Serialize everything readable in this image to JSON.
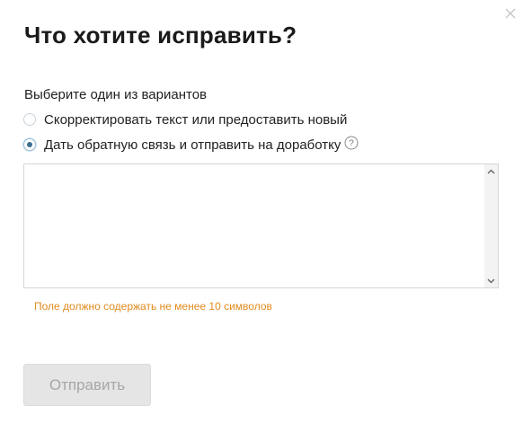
{
  "dialog": {
    "title": "Что хотите исправить?",
    "prompt": "Выберите один из вариантов",
    "options": [
      {
        "label": "Скорректировать текст или предоставить новый",
        "selected": false
      },
      {
        "label": "Дать обратную связь и отправить на доработку",
        "selected": true,
        "has_help_icon": true
      }
    ],
    "feedback_field": {
      "value": "",
      "placeholder": ""
    },
    "error_message": "Поле должно содержать не менее 10 символов",
    "submit_label": "Отправить",
    "submit_enabled": false
  },
  "colors": {
    "error": "#e08b1e",
    "radio_checked": "#3a6f8f",
    "button_disabled_bg": "#e5e5e5",
    "button_disabled_text": "#a7a7a7"
  },
  "icons": [
    "close-icon",
    "help-icon",
    "scroll-up-arrow-icon",
    "scroll-down-arrow-icon"
  ]
}
